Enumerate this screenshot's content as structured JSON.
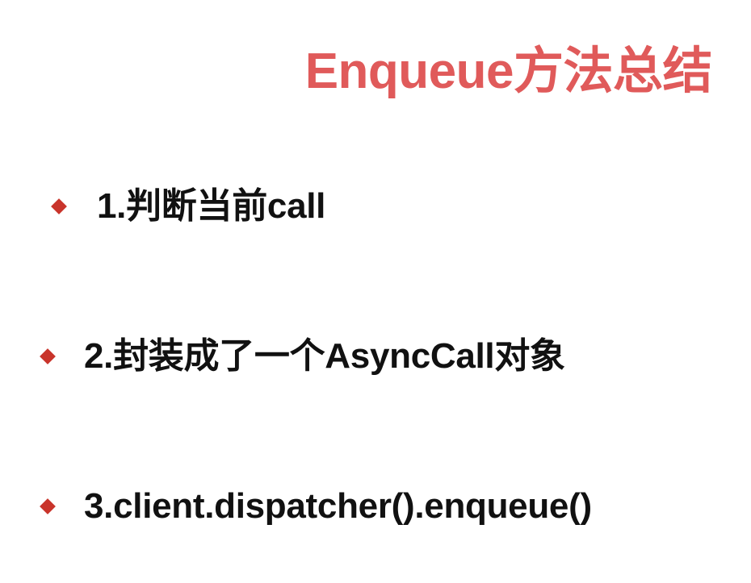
{
  "slide": {
    "title": "Enqueue方法总结",
    "bullets": [
      {
        "text": "1.判断当前call"
      },
      {
        "text": "2.封装成了一个AsyncCall对象"
      },
      {
        "text": "3.client.dispatcher().enqueue()"
      }
    ]
  },
  "colors": {
    "title": "#e05a5a",
    "bullet_marker": "#c9342b",
    "text": "#111111",
    "background": "#ffffff"
  },
  "icons": {
    "bullet_marker": "diamond-bullet-icon"
  }
}
